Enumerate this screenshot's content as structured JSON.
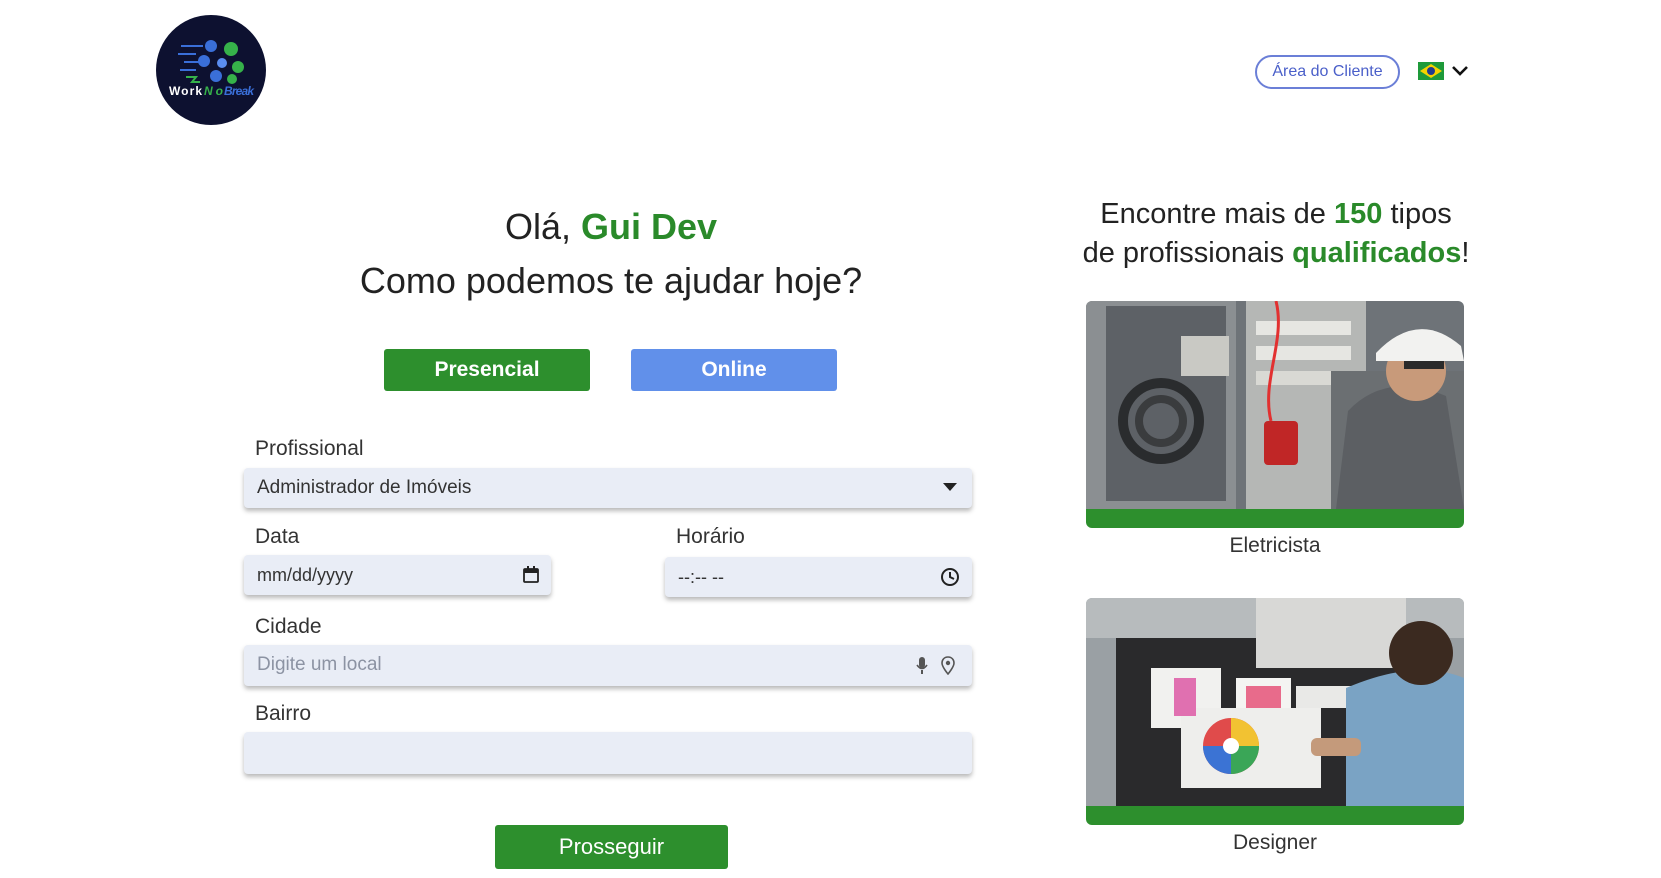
{
  "header": {
    "logo_text": "Work No Break",
    "area_button": "Área do Cliente",
    "language": {
      "flag": "brazil-flag",
      "icon": "chevron-down-icon"
    }
  },
  "greeting": {
    "hello": "Olá,",
    "name": "Gui Dev",
    "question": "Como podemos te ajudar hoje?"
  },
  "mode_tabs": {
    "presencial": "Presencial",
    "online": "Online",
    "colors": {
      "presencial": "#2d8f2d",
      "online": "#6190ea"
    }
  },
  "form": {
    "profissional": {
      "label": "Profissional",
      "value": "Administrador de Imóveis"
    },
    "data": {
      "label": "Data",
      "placeholder": "mm/dd/yyyy"
    },
    "horario": {
      "label": "Horário",
      "placeholder": "--:-- --"
    },
    "cidade": {
      "label": "Cidade",
      "placeholder": "Digite um local"
    },
    "bairro": {
      "label": "Bairro",
      "value": ""
    },
    "submit": "Prosseguir"
  },
  "promo": {
    "prefix": "Encontre mais de",
    "count": "150",
    "middle": "tipos",
    "line2_prefix": "de profissionais",
    "highlight": "qualificados",
    "suffix": "!"
  },
  "cards": [
    {
      "caption": "Eletricista",
      "image": "electrician-photo"
    },
    {
      "caption": "Designer",
      "image": "designer-photo"
    }
  ],
  "colors": {
    "brand_green": "#2d8f2d",
    "accent_blue": "#6190ea",
    "field_bg": "#e9edf6"
  }
}
